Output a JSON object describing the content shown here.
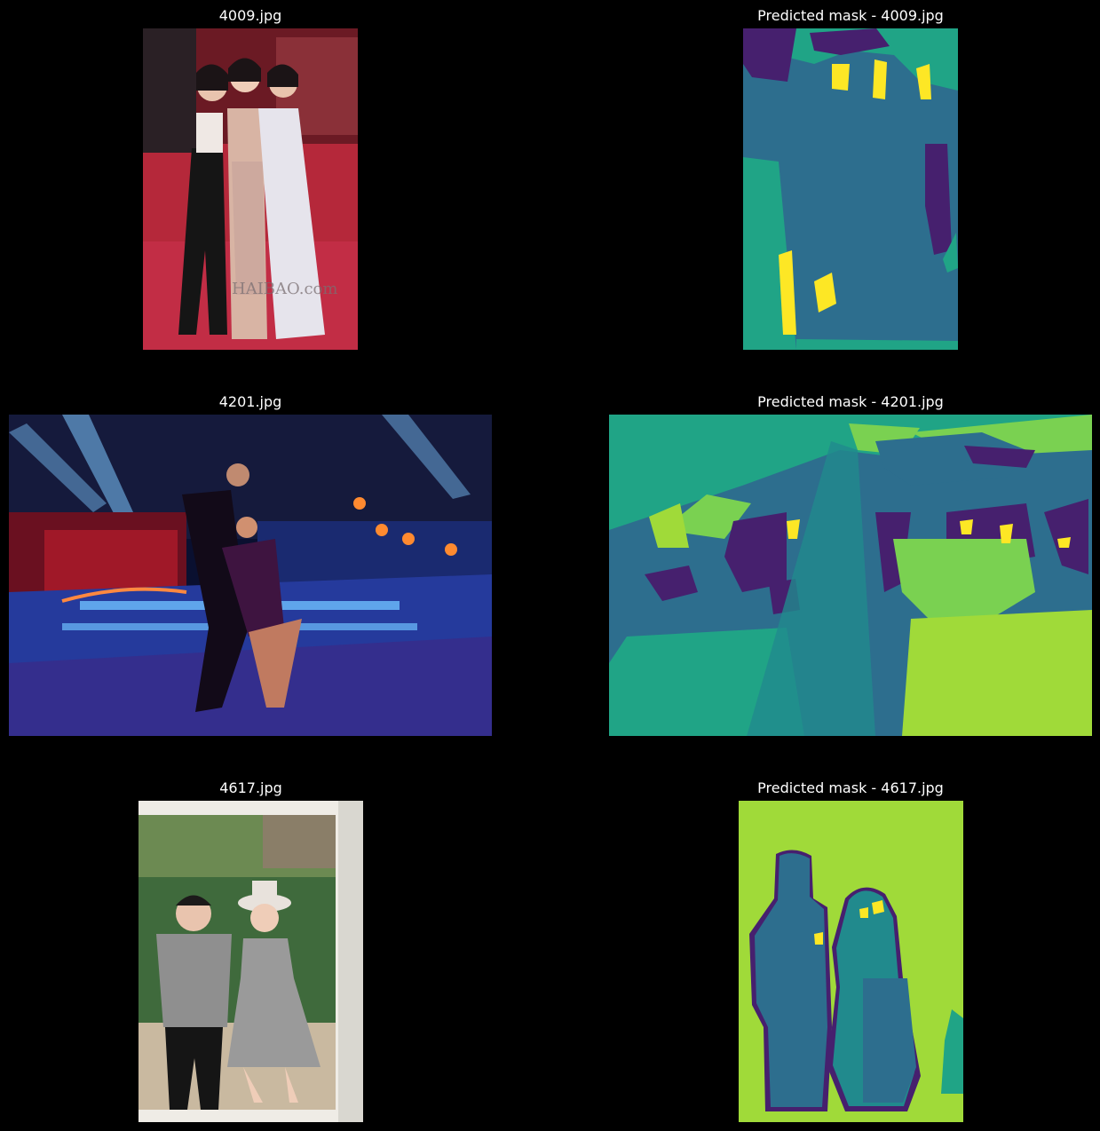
{
  "rows": [
    {
      "photo_title": "4009.jpg",
      "mask_title": "Predicted mask - 4009.jpg",
      "watermark": "HAIBAO.com"
    },
    {
      "photo_title": "4201.jpg",
      "mask_title": "Predicted mask - 4201.jpg"
    },
    {
      "photo_title": "4617.jpg",
      "mask_title": "Predicted mask - 4617.jpg"
    }
  ],
  "mask_palette": {
    "purple": "#46206e",
    "blue": "#2d6e8e",
    "teal": "#218a8d",
    "green": "#20a486",
    "lightgreen": "#7ad151",
    "lime": "#a0da39",
    "yellow": "#fde725"
  }
}
